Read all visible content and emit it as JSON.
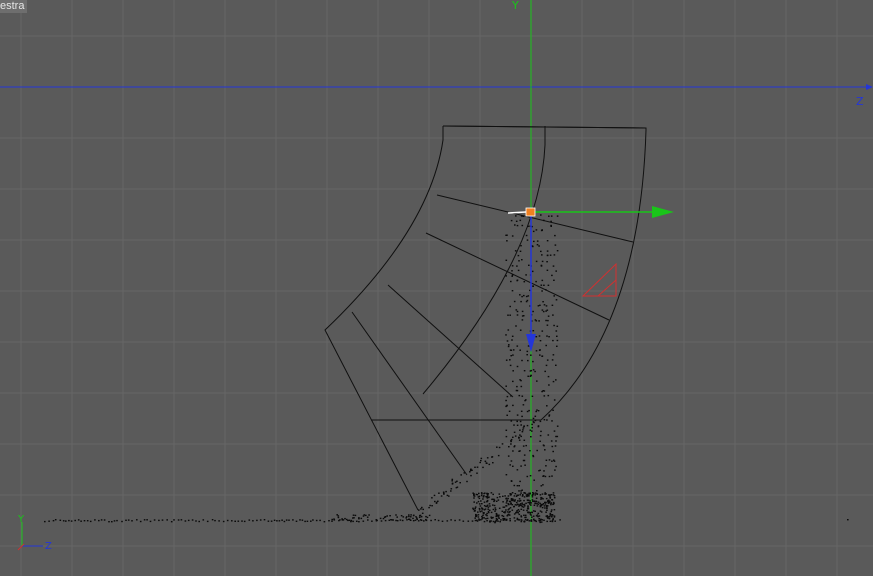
{
  "viewport": {
    "view_name": "estra",
    "top_axis_label": "Y",
    "right_axis_label": "Z",
    "corner_axes": {
      "y": "Y",
      "z": "Z"
    }
  },
  "colors": {
    "background": "#5a5a5a",
    "grid": "#666666",
    "blue_axis": "#2436d8",
    "green_axis": "#19c519",
    "wireframe": "#101010",
    "handle": "#f08020",
    "red_gizmo": "#d23030"
  },
  "icons": [
    "move-gizmo",
    "rotation-gizmo",
    "axis-widget"
  ]
}
